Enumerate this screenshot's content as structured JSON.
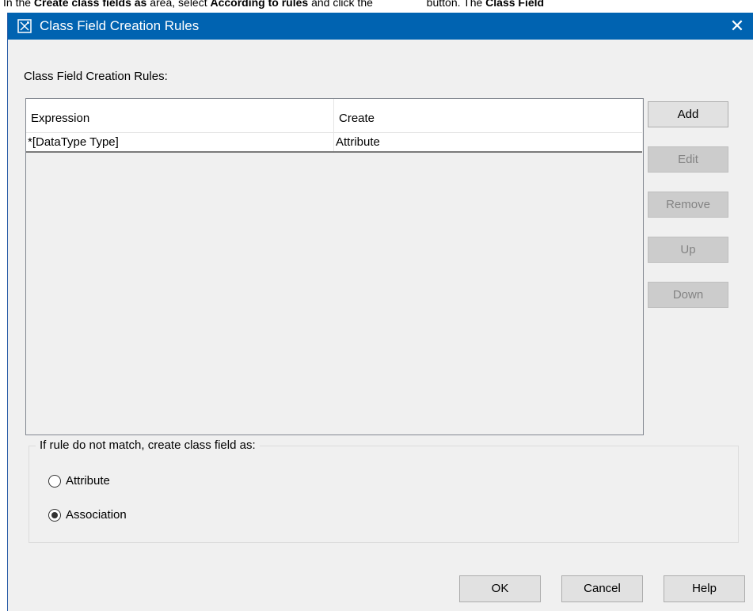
{
  "caption": {
    "part1": "In the ",
    "bold1": "Create class fields as",
    "part2": " area, select ",
    "bold2": "According to rules",
    "part3": " and click the ",
    "part4": " button. The ",
    "bold3": "Class Field"
  },
  "window": {
    "title": "Class Field Creation Rules",
    "close_glyph": "✕"
  },
  "rules": {
    "label": "Class Field Creation Rules:",
    "columns": [
      "Expression",
      "Create"
    ],
    "rows": [
      {
        "expression": "*[DataType Type]",
        "create": "Attribute"
      }
    ]
  },
  "side_buttons": {
    "add": "Add",
    "edit": "Edit",
    "remove": "Remove",
    "up": "Up",
    "down": "Down"
  },
  "fallback": {
    "legend": "If rule do not match, create class field as:",
    "options": [
      "Attribute",
      "Association"
    ],
    "selected": "Association"
  },
  "footer": {
    "ok": "OK",
    "cancel": "Cancel",
    "help": "Help"
  },
  "colors": {
    "titlebar": "#0063b1",
    "dialog_bg": "#f0f0f0"
  }
}
